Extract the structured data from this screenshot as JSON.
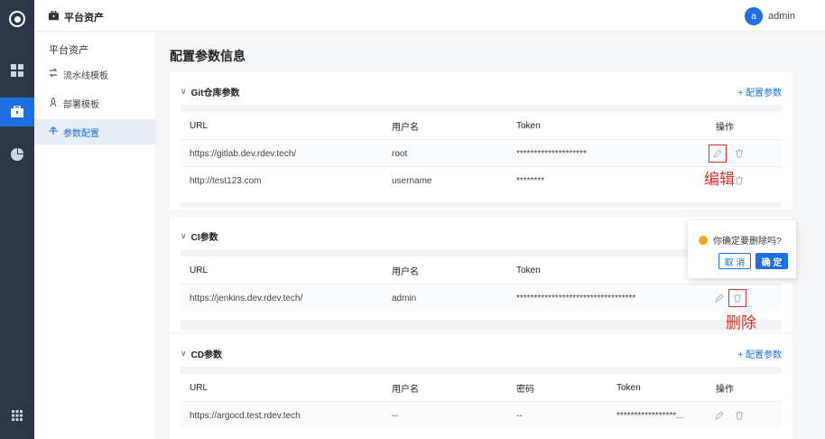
{
  "app": {
    "title": "平台资产",
    "user_initial": "a",
    "user_name": "admin"
  },
  "sidebar": {
    "section_title": "平台资产",
    "items": [
      {
        "label": "流水线模板"
      },
      {
        "label": "部署模板"
      },
      {
        "label": "参数配置"
      }
    ]
  },
  "page": {
    "title": "配置参数信息"
  },
  "git_card": {
    "title": "Git仓库参数",
    "action": "+ 配置参数",
    "headers": {
      "url": "URL",
      "user": "用户名",
      "token": "Token",
      "ops": "操作"
    },
    "rows": [
      {
        "url": "https://gitlab.dev.rdev.tech/",
        "user": "root",
        "token": "********************"
      },
      {
        "url": "http://test123.com",
        "user": "username",
        "token": "********"
      }
    ]
  },
  "ci_card": {
    "title": "CI参数",
    "headers": {
      "url": "URL",
      "user": "用户名",
      "token": "Token"
    },
    "rows": [
      {
        "url": "https://jenkins.dev.rdev.tech/",
        "user": "admin",
        "token": "**********************************"
      }
    ]
  },
  "cd_card": {
    "title": "CD参数",
    "action": "+ 配置参数",
    "headers": {
      "url": "URL",
      "user": "用户名",
      "password": "密码",
      "token": "Token",
      "ops": "操作"
    },
    "rows": [
      {
        "url": "https://argocd.test.rdev.tech",
        "user": "--",
        "password": "--",
        "token": "*****************..."
      }
    ]
  },
  "annotations": {
    "edit": "编辑",
    "delete": "删除"
  },
  "popconfirm": {
    "question": "你确定要删除吗?",
    "cancel": "取 消",
    "confirm": "确 定"
  },
  "colors": {
    "primary": "#1f6fe0",
    "rail": "#2d3748",
    "annotation": "#d93025",
    "warning": "#f0a81b"
  }
}
